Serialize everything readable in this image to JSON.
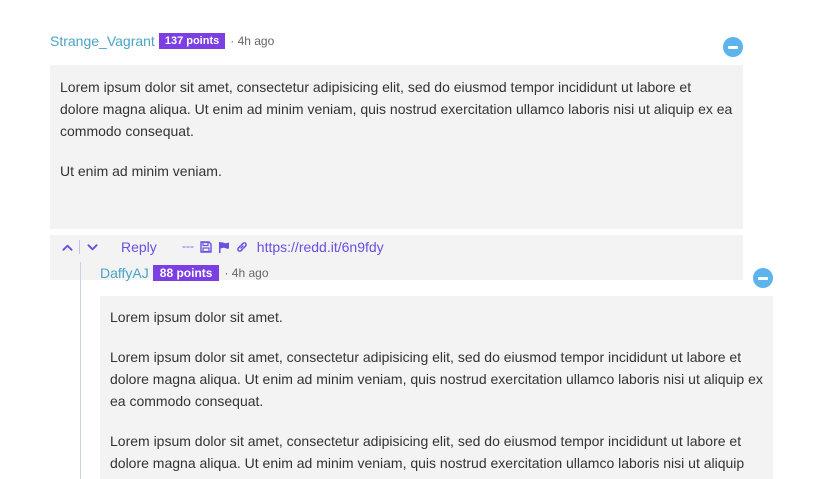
{
  "comments": [
    {
      "author": "Strange_Vagrant",
      "points": "137 points",
      "time": "· 4h ago",
      "paragraphs": [
        "Lorem ipsum dolor sit amet, consectetur adipisicing elit, sed do eiusmod tempor incididunt ut labore et dolore magna aliqua. Ut enim ad minim veniam, quis nostrud exercitation ullamco laboris nisi ut aliquip ex ea commodo consequat.",
        "Ut enim ad minim veniam."
      ],
      "actions": {
        "reply_label": "Reply",
        "link_text": "https://redd.it/6n9fdy"
      }
    },
    {
      "author": "DaffyAJ",
      "points": "88 points",
      "time": "· 4h ago",
      "paragraphs": [
        "Lorem ipsum dolor sit amet.",
        "Lorem ipsum dolor sit amet, consectetur adipisicing elit, sed do eiusmod tempor incididunt ut labore et dolore magna aliqua. Ut enim ad minim veniam, quis nostrud exercitation ullamco laboris nisi ut aliquip ex ea commodo consequat.",
        "Lorem ipsum dolor sit amet, consectetur adipisicing elit, sed do eiusmod tempor incididunt ut labore et dolore magna aliqua. Ut enim ad minim veniam, quis nostrud exercitation ullamco laboris nisi ut aliquip"
      ]
    }
  ],
  "icons": {
    "upvote": "chevron-up-icon",
    "downvote": "chevron-down-icon",
    "more": "more-dots-icon",
    "save": "save-icon",
    "report": "flag-icon",
    "permalink": "link-icon",
    "collapse": "collapse-minus-icon"
  },
  "colors": {
    "author": "#48a4c6",
    "badge": "#7b3fe4",
    "action": "#6a4fe0",
    "collapse": "#5db3ec",
    "body_bg": "#f3f3f3"
  }
}
